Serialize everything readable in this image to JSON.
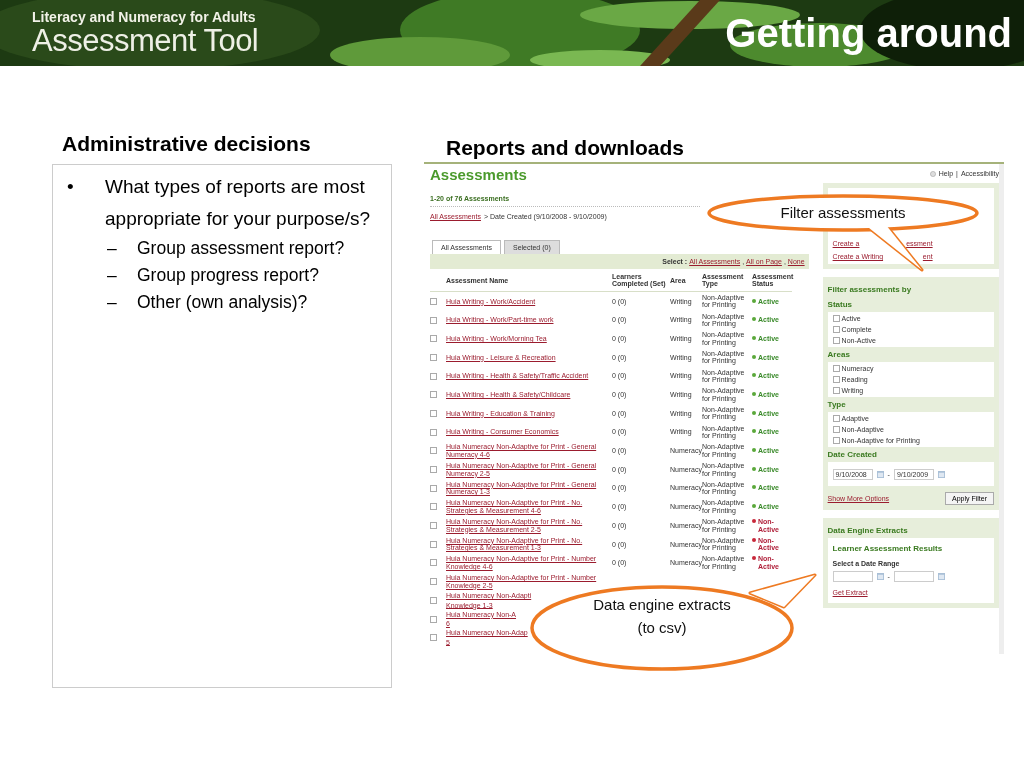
{
  "banner": {
    "kicker": "Literacy and Numeracy for Adults",
    "product": "Assessment Tool",
    "title": "Getting around"
  },
  "left": {
    "heading": "Administrative decisions",
    "items": [
      {
        "marker": "•",
        "text": "What types of reports are most appropriate for your purpose/s?",
        "children": [
          {
            "marker": "–",
            "text": "Group assessment report?"
          },
          {
            "marker": "–",
            "text": "Group progress report?"
          },
          {
            "marker": "–",
            "text": "Other (own analysis)?"
          }
        ]
      }
    ]
  },
  "right": {
    "heading": "Reports and downloads",
    "app": {
      "title": "Assessments",
      "top_links": [
        {
          "kind": "help",
          "text": "Help"
        },
        {
          "kind": "separator",
          "text": "|"
        },
        {
          "kind": "link",
          "text": "Accessibility"
        }
      ],
      "count": "1-20 of 76 Assessments",
      "breadcrumb": {
        "link": "All Assessments",
        "rest": "> Date Created (9/10/2008 - 9/10/2009)"
      },
      "tabs": [
        {
          "label": "All Assessments",
          "selected": true
        },
        {
          "label": "Selected (0)",
          "selected": false
        }
      ],
      "select_bar": {
        "label": "Select :",
        "items": [
          {
            "kind": "link",
            "text": "All Assessments"
          },
          {
            "kind": "separator",
            "text": ","
          },
          {
            "kind": "link",
            "text": "All on Page"
          },
          {
            "kind": "separator",
            "text": ","
          },
          {
            "kind": "link",
            "text": "None"
          }
        ]
      },
      "columns": [
        "Assessment Name",
        "Learners Completed (Set)",
        "Area",
        "Assessment Type",
        "Assessment Status"
      ],
      "rows": [
        {
          "checked": false,
          "name": "Huia Writing - Work/Accident",
          "learners": "0 (0)",
          "area": "Writing",
          "type": "Non-Adaptive for Printing",
          "status": "Active",
          "active": true
        },
        {
          "checked": false,
          "name": "Huia Writing - Work/Part-time work",
          "learners": "0 (0)",
          "area": "Writing",
          "type": "Non-Adaptive for Printing",
          "status": "Active",
          "active": true
        },
        {
          "checked": false,
          "name": "Huia Writing - Work/Morning Tea",
          "learners": "0 (0)",
          "area": "Writing",
          "type": "Non-Adaptive for Printing",
          "status": "Active",
          "active": true
        },
        {
          "checked": false,
          "name": "Huia Writing - Leisure & Recreation",
          "learners": "0 (0)",
          "area": "Writing",
          "type": "Non-Adaptive for Printing",
          "status": "Active",
          "active": true
        },
        {
          "checked": false,
          "name": "Huia Writing - Health & Safety/Traffic Accident",
          "learners": "0 (0)",
          "area": "Writing",
          "type": "Non-Adaptive for Printing",
          "status": "Active",
          "active": true
        },
        {
          "checked": false,
          "name": "Huia Writing - Health & Safety/Childcare",
          "learners": "0 (0)",
          "area": "Writing",
          "type": "Non-Adaptive for Printing",
          "status": "Active",
          "active": true
        },
        {
          "checked": false,
          "name": "Huia Writing - Education & Training",
          "learners": "0 (0)",
          "area": "Writing",
          "type": "Non-Adaptive for Printing",
          "status": "Active",
          "active": true
        },
        {
          "checked": false,
          "name": "Huia Writing - Consumer Economics",
          "learners": "0 (0)",
          "area": "Writing",
          "type": "Non-Adaptive for Printing",
          "status": "Active",
          "active": true
        },
        {
          "checked": false,
          "name": "Huia Numeracy Non-Adaptive for Print - General Numeracy 4-6",
          "learners": "0 (0)",
          "area": "Numeracy",
          "type": "Non-Adaptive for Printing",
          "status": "Active",
          "active": true
        },
        {
          "checked": false,
          "name": "Huia Numeracy Non-Adaptive for Print - General Numeracy 2-5",
          "learners": "0 (0)",
          "area": "Numeracy",
          "type": "Non-Adaptive for Printing",
          "status": "Active",
          "active": true
        },
        {
          "checked": false,
          "name": "Huia Numeracy Non-Adaptive for Print - General Numeracy 1-3",
          "learners": "0 (0)",
          "area": "Numeracy",
          "type": "Non-Adaptive for Printing",
          "status": "Active",
          "active": true
        },
        {
          "checked": false,
          "name": "Huia Numeracy Non-Adaptive for Print - No. Strategies & Measurement 4-6",
          "learners": "0 (0)",
          "area": "Numeracy",
          "type": "Non-Adaptive for Printing",
          "status": "Active",
          "active": true
        },
        {
          "checked": false,
          "name": "Huia Numeracy Non-Adaptive for Print - No. Strategies & Measurement 2-5",
          "learners": "0 (0)",
          "area": "Numeracy",
          "type": "Non-Adaptive for Printing",
          "status": "Non-Active",
          "active": false
        },
        {
          "checked": false,
          "name": "Huia Numeracy Non-Adaptive for Print - No. Strategies & Measurement 1-3",
          "learners": "0 (0)",
          "area": "Numeracy",
          "type": "Non-Adaptive for Printing",
          "status": "Non-Active",
          "active": false
        },
        {
          "checked": false,
          "name": "Huia Numeracy Non-Adaptive for Print - Number Knowledge 4-6",
          "learners": "0 (0)",
          "area": "Numeracy",
          "type": "Non-Adaptive for Printing",
          "status": "Non-Active",
          "active": false
        },
        {
          "checked": false,
          "name": "Huia Numeracy Non-Adaptive for Print - Number Knowledge 2-5"
        },
        {
          "checked": false,
          "name": "Huia Numeracy Non-Adapti",
          "name_cont": "Knowledge 1-3"
        },
        {
          "checked": false,
          "name": "Huia Numeracy Non-A",
          "name_cont": "6"
        },
        {
          "checked": false,
          "name": "Huia Numeracy Non-Adap",
          "name_cont": "5"
        }
      ],
      "sidebar": {
        "create_links": [
          {
            "parts": [
              "Create a",
              "essment"
            ]
          },
          {
            "parts": [
              "Create a Writing",
              "ent"
            ]
          }
        ],
        "filter": {
          "title": "Filter assessments by",
          "groups": [
            {
              "title": "Status",
              "options": [
                {
                  "label": "Active",
                  "checked": false
                },
                {
                  "label": "Complete",
                  "checked": false
                },
                {
                  "label": "Non-Active",
                  "checked": false
                }
              ]
            },
            {
              "title": "Areas",
              "options": [
                {
                  "label": "Numeracy",
                  "checked": false
                },
                {
                  "label": "Reading",
                  "checked": false
                },
                {
                  "label": "Writing",
                  "checked": false
                }
              ]
            },
            {
              "title": "Type",
              "options": [
                {
                  "label": "Adaptive",
                  "checked": false
                },
                {
                  "label": "Non-Adaptive",
                  "checked": false
                },
                {
                  "label": "Non-Adaptive for Printing",
                  "checked": false
                }
              ]
            }
          ],
          "date": {
            "title": "Date Created",
            "from": "9/10/2008",
            "separator": "-",
            "to": "9/10/2009"
          },
          "more_link": "Show More Options",
          "apply": "Apply Filter"
        },
        "extracts": {
          "title": "Data Engine Extracts",
          "subtitle": "Learner Assessment Results",
          "range_label": "Select a Date Range",
          "separator": "-",
          "link": "Get Extract"
        }
      }
    }
  },
  "callouts": [
    {
      "text": "Filter assessments"
    },
    {
      "text": "Data engine extracts (to csv)"
    }
  ]
}
